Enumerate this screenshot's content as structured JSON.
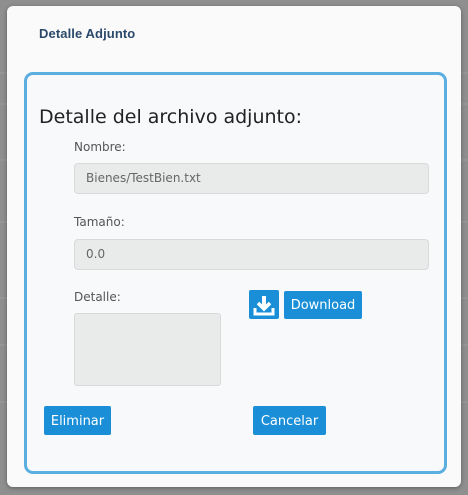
{
  "dialog": {
    "title": "Detalle Adjunto"
  },
  "panel": {
    "heading": "Detalle del archivo adjunto:",
    "nombre_label": "Nombre:",
    "nombre_value": "Bienes/TestBien.txt",
    "tamano_label": "Tamaño:",
    "tamano_value": "0.0",
    "detalle_label": "Detalle:",
    "detalle_value": "",
    "download_icon": "download-icon",
    "download_label": "Download",
    "eliminar_label": "Eliminar",
    "cancelar_label": "Cancelar"
  },
  "colors": {
    "accent": "#1a8fd8",
    "panel_border": "#5aaee0",
    "title_text": "#2b4a6b"
  }
}
